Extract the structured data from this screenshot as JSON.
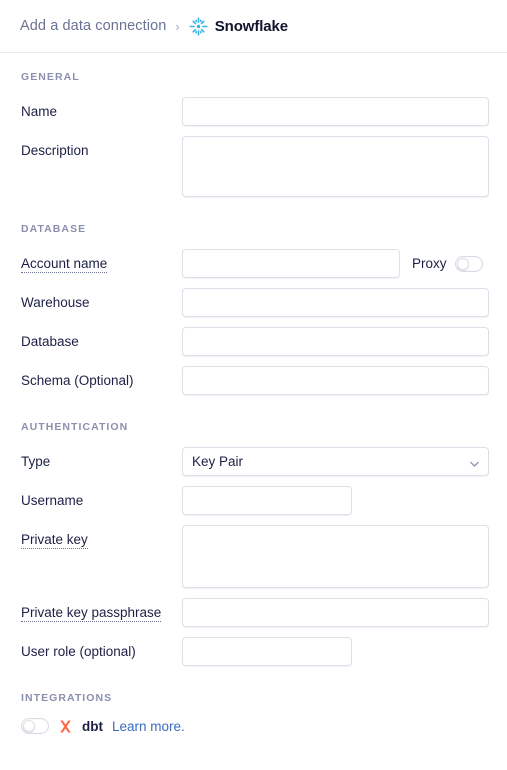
{
  "header": {
    "breadcrumb_root": "Add a data connection",
    "breadcrumb_separator": "›",
    "title": "Snowflake",
    "logo_icon": "snowflake-icon",
    "logo_color": "#35b4e9"
  },
  "sections": {
    "general": {
      "heading": "GENERAL",
      "name_label": "Name",
      "name_value": "",
      "name_placeholder": "",
      "description_label": "Description",
      "description_value": "",
      "description_placeholder": ""
    },
    "database": {
      "heading": "DATABASE",
      "account_name_label": "Account name",
      "account_name_value": "",
      "proxy_label": "Proxy",
      "proxy_enabled": false,
      "warehouse_label": "Warehouse",
      "warehouse_value": "",
      "database_label": "Database",
      "database_value": "",
      "schema_label": "Schema (Optional)",
      "schema_value": ""
    },
    "authentication": {
      "heading": "AUTHENTICATION",
      "type_label": "Type",
      "type_value": "Key Pair",
      "type_options": [
        "Key Pair"
      ],
      "type_chevron_icon": "chevron-down-icon",
      "username_label": "Username",
      "username_value": "",
      "private_key_label": "Private key",
      "private_key_value": "",
      "private_key_passphrase_label": "Private key passphrase",
      "private_key_passphrase_value": "",
      "user_role_label": "User role (optional)",
      "user_role_value": ""
    },
    "integrations": {
      "heading": "INTEGRATIONS",
      "dbt_enabled": false,
      "dbt_logo_icon": "dbt-icon",
      "dbt_logo_color": "#ff694a",
      "dbt_name": "dbt",
      "learn_more_label": "Learn more.",
      "learn_more_color": "#3a6bbf"
    }
  }
}
